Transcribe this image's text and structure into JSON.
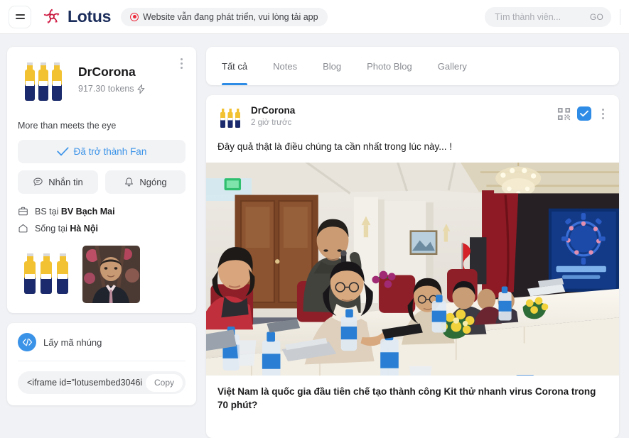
{
  "header": {
    "menu_icon": "hamburger-icon",
    "brand_name": "Lotus",
    "brand_logo_icon": "lotus-flower-logo",
    "notice": {
      "icon": "record-dot-icon",
      "text": "Website vẫn đang phát triển, vui lòng tải app"
    },
    "search": {
      "placeholder": "Tìm thành viên...",
      "value": "",
      "go_label": "GO"
    }
  },
  "profile": {
    "avatar_icon": "corona-bottles-avatar",
    "name": "DrCorona",
    "tokens": "917.30 tokens",
    "tokens_icon": "lightning-bolt-icon",
    "menu_icon": "kebab-menu-icon",
    "bio": "More than meets the eye",
    "fan_button": {
      "label": "Đã trở thành Fan",
      "icon": "check-icon"
    },
    "message_button": {
      "label": "Nhắn tin",
      "icon": "chat-bubble-icon"
    },
    "follow_button": {
      "label": "Ngóng",
      "icon": "bell-icon"
    },
    "info": [
      {
        "icon": "briefcase-icon",
        "prefix": "BS tại ",
        "value": "BV Bạch Mai"
      },
      {
        "icon": "home-icon",
        "prefix": "Sống tại ",
        "value": "Hà Nội"
      }
    ],
    "photos": [
      {
        "name": "photo-corona-bottles"
      },
      {
        "name": "photo-portrait-man"
      }
    ]
  },
  "embed": {
    "icon": "code-icon",
    "icon_glyph": "</>",
    "title": "Lấy mã nhúng",
    "code_value": "<iframe id=\"lotusembed3046i",
    "copy_label": "Copy"
  },
  "tabs": [
    {
      "label": "Tất cả",
      "active": true
    },
    {
      "label": "Notes",
      "active": false
    },
    {
      "label": "Blog",
      "active": false
    },
    {
      "label": "Photo Blog",
      "active": false
    },
    {
      "label": "Gallery",
      "active": false
    }
  ],
  "post": {
    "avatar_icon": "corona-bottles-avatar",
    "author": "DrCorona",
    "time": "2 giờ trước",
    "qr_icon": "qr-code-icon",
    "verified_icon": "verified-check-icon",
    "menu_icon": "kebab-menu-icon",
    "text": "Đây quả thật là điều chúng ta cần nhất trong lúc này... !",
    "photo_name": "conference-room-press-photo",
    "article_title": "Việt Nam là quốc gia đầu tiên chế tạo thành công Kit thử nhanh virus Corona trong 70 phút?"
  },
  "colors": {
    "brand_red": "#c8163c",
    "brand_navy": "#1b2d5b",
    "accent_blue": "#2f8ce6",
    "link_blue": "#3b93e8",
    "notice_red": "#ec2b3d",
    "page_bg": "#f0f2f5",
    "card_bg": "#ffffff"
  }
}
